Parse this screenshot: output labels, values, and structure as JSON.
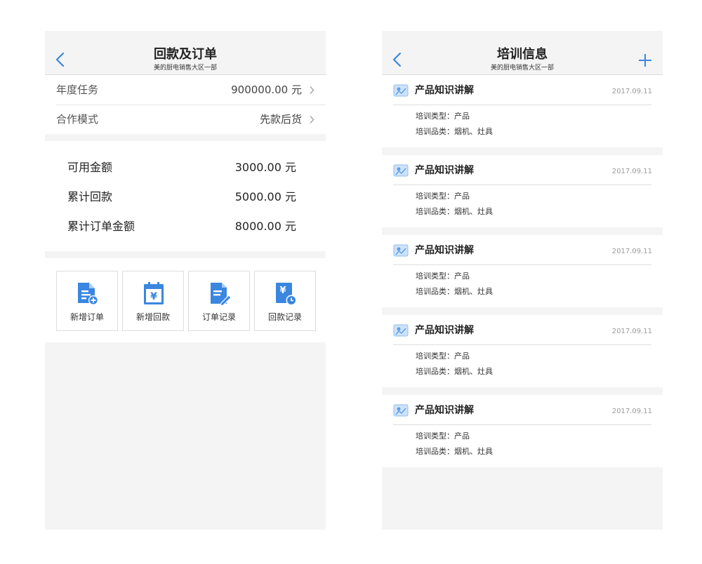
{
  "left_screen": {
    "nav": {
      "title": "回款及订单",
      "subtitle": "美的厨电销售大区一部",
      "back_icon": "chevron-left-icon"
    },
    "settings": [
      {
        "label": "年度任务",
        "value": "900000.00  元"
      },
      {
        "label": "合作模式",
        "value": "先款后货"
      }
    ],
    "summary": [
      {
        "label": "可用金额",
        "value": "3000.00  元"
      },
      {
        "label": "累计回款",
        "value": "5000.00  元"
      },
      {
        "label": "累计订单金额",
        "value": "8000.00  元"
      }
    ],
    "actions": [
      {
        "label": "新增订单",
        "icon": "add-order-icon"
      },
      {
        "label": "新增回款",
        "icon": "add-payment-icon"
      },
      {
        "label": "订单记录",
        "icon": "order-record-icon"
      },
      {
        "label": "回款记录",
        "icon": "payment-record-icon"
      }
    ]
  },
  "right_screen": {
    "nav": {
      "title": "培训信息",
      "subtitle": "美的厨电销售大区一部",
      "back_icon": "chevron-left-icon",
      "add_icon": "plus-icon"
    },
    "items": [
      {
        "title": "产品知识讲解",
        "date": "2017.09.11",
        "type_line": "培训类型：产品",
        "category_line": "培训品类：烟机、灶具"
      },
      {
        "title": "产品知识讲解",
        "date": "2017.09.11",
        "type_line": "培训类型：产品",
        "category_line": "培训品类：烟机、灶具"
      },
      {
        "title": "产品知识讲解",
        "date": "2017.09.11",
        "type_line": "培训类型：产品",
        "category_line": "培训品类：烟机、灶具"
      },
      {
        "title": "产品知识讲解",
        "date": "2017.09.11",
        "type_line": "培训类型：产品",
        "category_line": "培训品类：烟机、灶具"
      },
      {
        "title": "产品知识讲解",
        "date": "2017.09.11",
        "type_line": "培训类型：产品",
        "category_line": "培训品类：烟机、灶具"
      }
    ]
  },
  "colors": {
    "accent": "#3a86e0",
    "background": "#f4f4f4",
    "panel": "#ffffff",
    "divider": "#dddddd"
  }
}
